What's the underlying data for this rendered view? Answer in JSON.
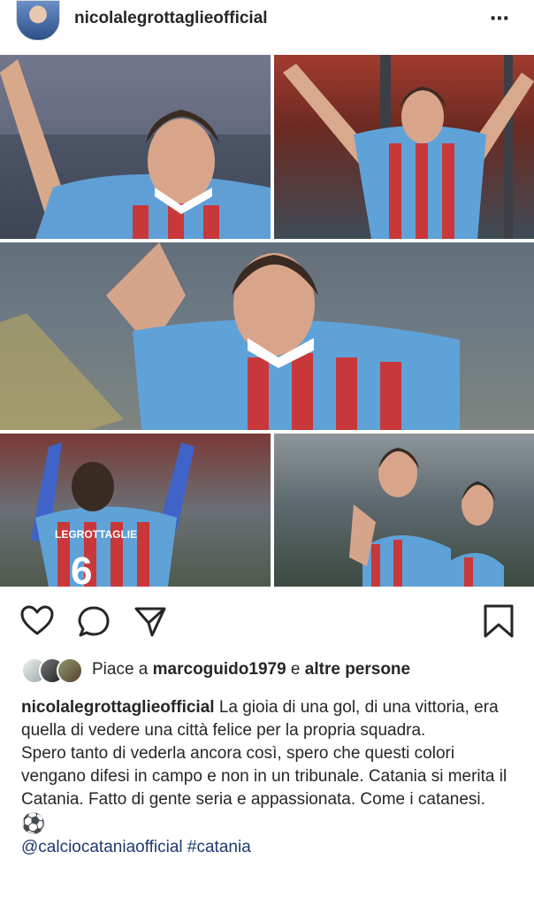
{
  "post": {
    "username": "nicolalegrottaglieofficial",
    "more_icon": "⋯"
  },
  "photos": {
    "p4_jersey_name": "LEGROTTAGLIE",
    "p4_jersey_number": "6"
  },
  "likes": {
    "prefix": "Piace a ",
    "user": "marcoguido1979",
    "middle": " e ",
    "suffix": "altre persone"
  },
  "caption": {
    "user": "nicolalegrottaglieofficial",
    "line1": " La gioia di una gol, di una vittoria, era quella di vedere una città felice per la propria squadra.",
    "line2": "Spero tanto di vederla ancora così, spero che questi colori vengano difesi in campo e non in un tribunale. Catania si merita il Catania. Fatto di gente seria e appassionata. Come i catanesi.",
    "emoji": "⚽️",
    "tags": "@calciocataniaofficial #catania"
  }
}
